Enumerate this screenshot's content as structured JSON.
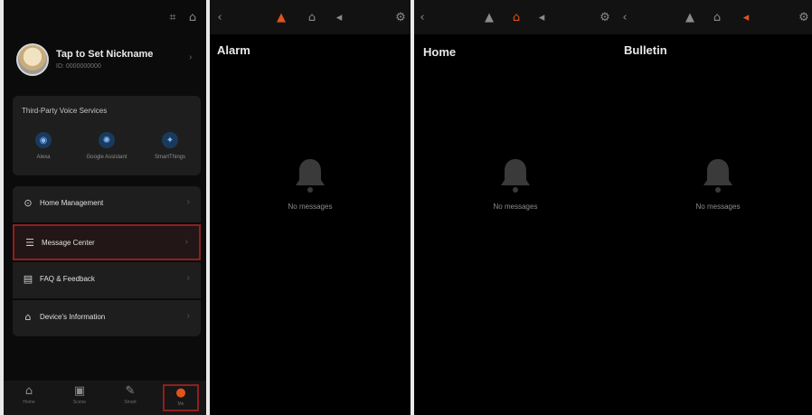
{
  "panel1": {
    "statusbar_icons": [
      "grid-icon",
      "home-icon"
    ],
    "profile": {
      "name": "Tap to Set Nickname",
      "subtitle": "ID: 0000000000"
    },
    "services": {
      "title": "Third-Party Voice Services",
      "items": [
        {
          "label": "Alexa",
          "icon": "alexa-icon"
        },
        {
          "label": "Google Assistant",
          "icon": "google-assistant-icon"
        },
        {
          "label": "SmartThings",
          "icon": "smartthings-icon"
        }
      ]
    },
    "menu": [
      {
        "label": "Home Management",
        "icon": "home-icon"
      },
      {
        "label": "Message Center",
        "icon": "message-icon",
        "highlighted": true
      },
      {
        "label": "FAQ & Feedback",
        "icon": "faq-icon"
      },
      {
        "label": "Device's Information",
        "icon": "device-icon"
      }
    ],
    "tabs": [
      {
        "label": "Home",
        "icon": "home-icon"
      },
      {
        "label": "Scene",
        "icon": "scene-icon"
      },
      {
        "label": "Smart",
        "icon": "smart-icon"
      },
      {
        "label": "Me",
        "icon": "me-icon",
        "active": true
      }
    ]
  },
  "panel2": {
    "title": "Alarm",
    "empty_text": "No messages"
  },
  "panel3": {
    "title": "Home",
    "empty_text": "No messages"
  },
  "panel4": {
    "title": "Bulletin",
    "empty_text": "No messages"
  },
  "colors": {
    "accent": "#e0541c",
    "highlight_border": "#8f1f1f",
    "background": "#000000"
  }
}
